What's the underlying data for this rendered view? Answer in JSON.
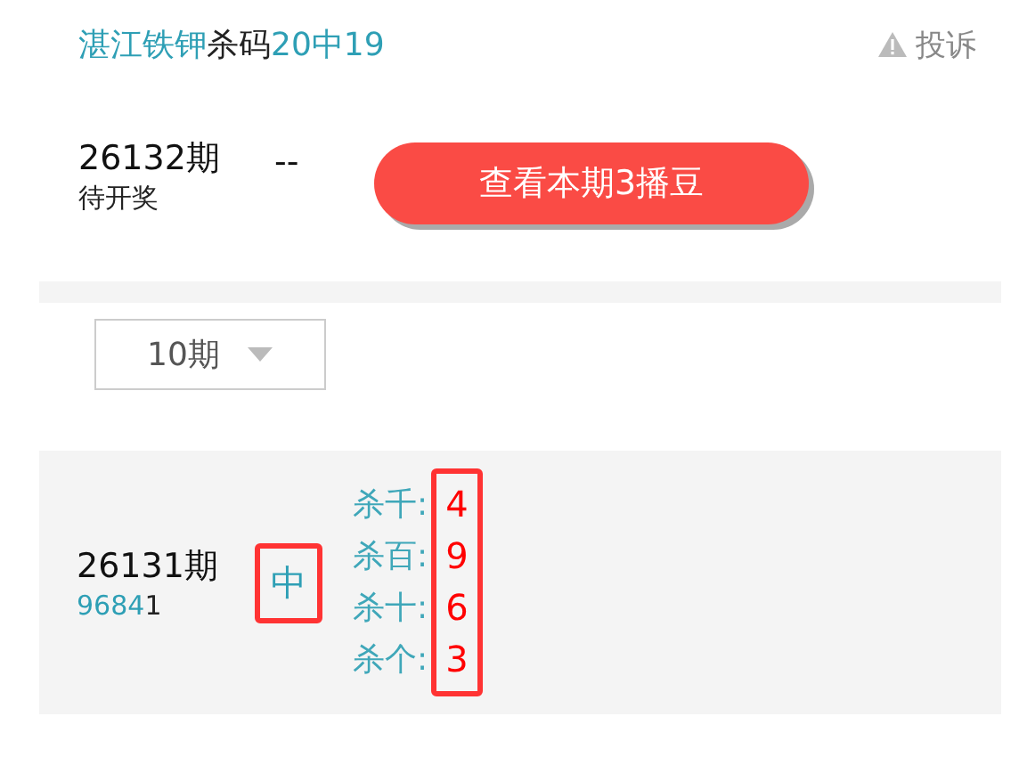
{
  "header": {
    "title": [
      {
        "text": "湛江铁钾",
        "highlight": true
      },
      {
        "text": "杀码",
        "highlight": false
      },
      {
        "text": "20中19",
        "highlight": true
      }
    ],
    "report": "投诉"
  },
  "current": {
    "issue": "26132期",
    "status": "待开奖",
    "result": "--",
    "button": "查看本期3播豆"
  },
  "filter": {
    "value": "10期"
  },
  "history": [
    {
      "issue": "26131期",
      "digits": [
        {
          "digit": "9",
          "hit": true
        },
        {
          "digit": "6",
          "hit": true
        },
        {
          "digit": "8",
          "hit": true
        },
        {
          "digit": "4",
          "hit": true
        },
        {
          "digit": "1",
          "hit": false
        }
      ],
      "outcome": "中",
      "kills": [
        {
          "label": "杀千:",
          "value": "4"
        },
        {
          "label": "杀百:",
          "value": "9"
        },
        {
          "label": "杀十:",
          "value": "6"
        },
        {
          "label": "杀个:",
          "value": "3"
        }
      ]
    }
  ]
}
